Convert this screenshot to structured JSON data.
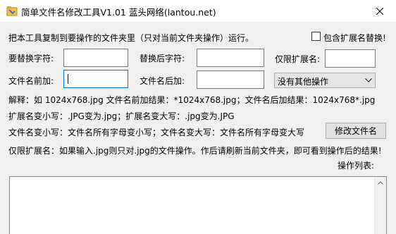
{
  "window": {
    "title": "简单文件名修改工具V1.01  蓝头网络(lantou.net)",
    "close_symbol": "✕"
  },
  "intro": "把本工具复制到要操作的文件夹里（只对当前文件夹操作）运行。",
  "include_extension": {
    "label": "包含扩展名替换!",
    "checked": false
  },
  "fields": {
    "replace_label": "要替换字符:",
    "replace_value": "",
    "replace_after_label": "替换后字符:",
    "replace_after_value": "",
    "ext_only_label": "仅限扩展名:",
    "ext_only_value": "",
    "prefix_label": "文件名前加:",
    "prefix_value": "",
    "suffix_label": "文件名后加:",
    "suffix_value": ""
  },
  "operation_select": {
    "selected": "没有其他操作"
  },
  "help": {
    "line1": "解释：如 1024x768.jpg 文件名前加结果：*1024x768.jpg；文件名后加结果：1024x768*.jpg",
    "line2": "扩展名变小写：.JPG变为.jpg；扩展名变大写：.jpg变为.JPG",
    "line3": "文件名变小写：文件名所有字母变小写；文件名变大写：文件名所有字母变大写",
    "line4": "仅限扩展名：如果输入.jpg则只对.jpg的文件操作。作后请刷新当前文件夹，即可看到操作后的结果!"
  },
  "rename_button": {
    "label": "修改文件名"
  },
  "operation_list": {
    "label": "操作列表:",
    "items": []
  },
  "icons": {
    "app": "app-icon",
    "close": "close-icon",
    "dropdown": "chevron-down-icon",
    "scroll_up": "scroll-up-arrow-icon"
  }
}
